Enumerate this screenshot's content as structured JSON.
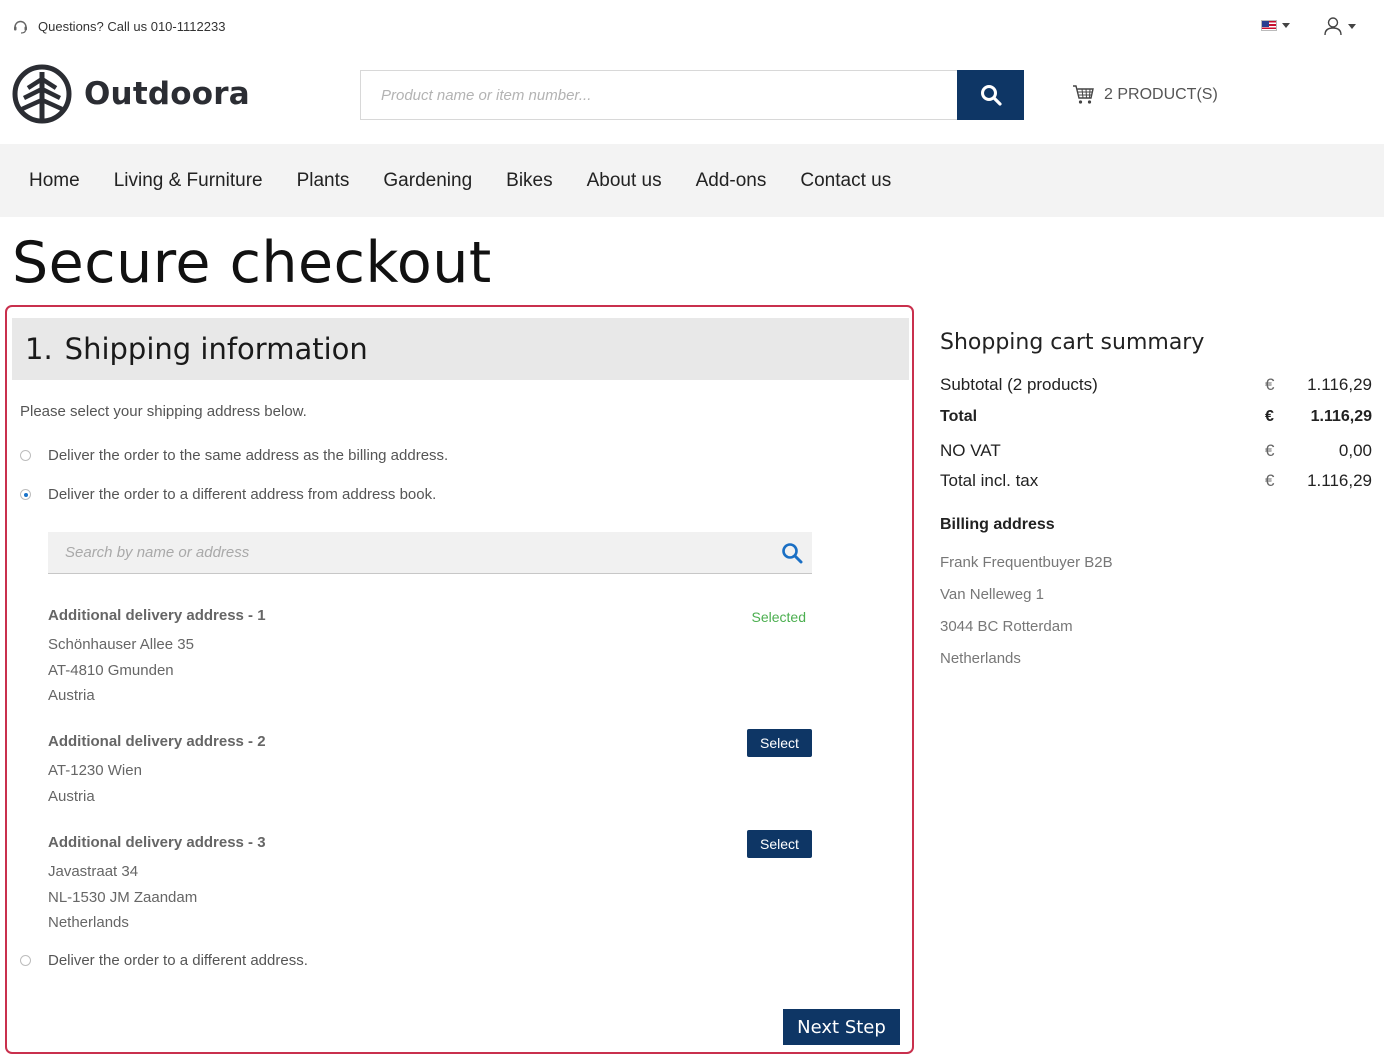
{
  "topbar": {
    "support_text": "Questions? Call us 010-1112233"
  },
  "header": {
    "logo_text": "Outdoora",
    "search_placeholder": "Product name or item number...",
    "cart_label": "2 PRODUCT(S)"
  },
  "nav": {
    "items": [
      "Home",
      "Living & Furniture",
      "Plants",
      "Gardening",
      "Bikes",
      "About us",
      "Add-ons",
      "Contact us"
    ]
  },
  "page": {
    "title": "Secure checkout"
  },
  "shipping": {
    "step_number": "1.",
    "step_title": "Shipping information",
    "intro": "Please select your shipping address below.",
    "options": [
      {
        "label": "Deliver the order to the same address as the billing address.",
        "checked": false
      },
      {
        "label": "Deliver the order to a different address from address book.",
        "checked": true
      },
      {
        "label": "Deliver the order to a different address.",
        "checked": false
      }
    ],
    "address_search_placeholder": "Search by name or address",
    "addresses": [
      {
        "title": "Additional delivery address - 1",
        "lines": [
          "Schönhauser Allee 35",
          "AT-4810 Gmunden",
          "Austria"
        ],
        "status": "Selected"
      },
      {
        "title": "Additional delivery address - 2",
        "lines": [
          "AT-1230 Wien",
          "Austria"
        ],
        "action": "Select"
      },
      {
        "title": "Additional delivery address - 3",
        "lines": [
          "Javastraat 34",
          "NL-1530 JM Zaandam",
          "Netherlands"
        ],
        "action": "Select"
      }
    ],
    "next_label": "Next Step"
  },
  "summary": {
    "title": "Shopping cart summary",
    "rows": [
      {
        "label": "Subtotal (2 products)",
        "currency": "€",
        "value": "1.116,29",
        "bold": false
      },
      {
        "label": "Total",
        "currency": "€",
        "value": "1.116,29",
        "bold": true
      },
      {
        "label": "NO VAT",
        "currency": "€",
        "value": "0,00",
        "bold": false
      },
      {
        "label": "Total incl. tax",
        "currency": "€",
        "value": "1.116,29",
        "bold": false
      }
    ],
    "billing_title": "Billing address",
    "billing_lines": [
      "Frank Frequentbuyer B2B",
      "Van Nelleweg 1",
      "3044 BC Rotterdam",
      "Netherlands"
    ]
  },
  "colors": {
    "brand": "#0e3665",
    "panel_border": "#c9304d",
    "selected": "#4caf50",
    "nav_bg": "#f3f3f3"
  }
}
